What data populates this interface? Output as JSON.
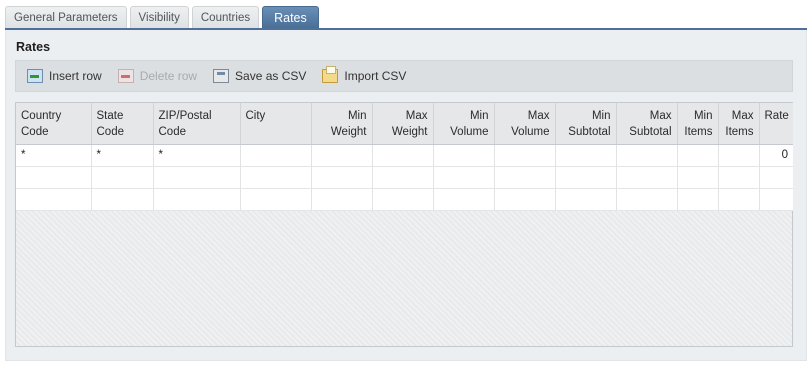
{
  "tabs": [
    {
      "label": "General Parameters",
      "active": false
    },
    {
      "label": "Visibility",
      "active": false
    },
    {
      "label": "Countries",
      "active": false
    },
    {
      "label": "Rates",
      "active": true
    }
  ],
  "panel": {
    "title": "Rates"
  },
  "toolbar": {
    "insert_row": {
      "label": "Insert row",
      "icon": "insert-row-icon",
      "enabled": true
    },
    "delete_row": {
      "label": "Delete row",
      "icon": "delete-row-icon",
      "enabled": false
    },
    "save_csv": {
      "label": "Save as CSV",
      "icon": "save-csv-icon",
      "enabled": true
    },
    "import_csv": {
      "label": "Import CSV",
      "icon": "import-csv-icon",
      "enabled": true
    }
  },
  "grid": {
    "columns": [
      {
        "line1": "Country",
        "line2": "Code"
      },
      {
        "line1": "State",
        "line2": "Code"
      },
      {
        "line1": "ZIP/Postal",
        "line2": "Code"
      },
      {
        "line1": "City",
        "line2": ""
      },
      {
        "line1": "Min",
        "line2": "Weight"
      },
      {
        "line1": "Max",
        "line2": "Weight"
      },
      {
        "line1": "Min",
        "line2": "Volume"
      },
      {
        "line1": "Max",
        "line2": "Volume"
      },
      {
        "line1": "Min",
        "line2": "Subtotal"
      },
      {
        "line1": "Max",
        "line2": "Subtotal"
      },
      {
        "line1": "Min",
        "line2": "Items"
      },
      {
        "line1": "Max",
        "line2": "Items"
      },
      {
        "line1": "Rate",
        "line2": ""
      }
    ],
    "rows": [
      [
        "*",
        "*",
        "*",
        "",
        "",
        "",
        "",
        "",
        "",
        "",
        "",
        "",
        "0"
      ],
      [
        "",
        "",
        "",
        "",
        "",
        "",
        "",
        "",
        "",
        "",
        "",
        "",
        ""
      ],
      [
        "",
        "",
        "",
        "",
        "",
        "",
        "",
        "",
        "",
        "",
        "",
        "",
        ""
      ]
    ]
  },
  "colors": {
    "active_tab": "#4f7099",
    "panel_bg": "#eceff1",
    "toolbar_bg": "#dcdfe1"
  }
}
